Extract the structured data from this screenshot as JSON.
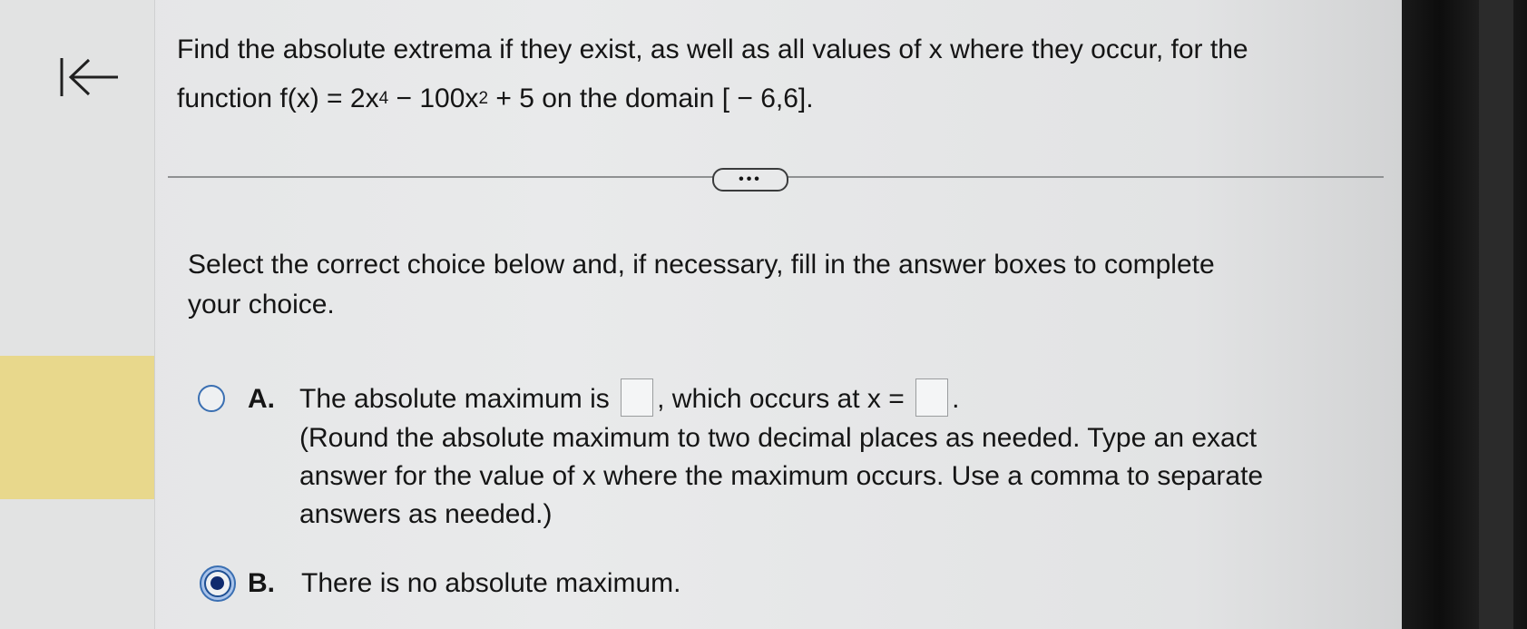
{
  "question": {
    "line1": "Find the absolute extrema if they exist, as well as all values of x where they occur, for the",
    "line2_prefix": "function f(x) = 2x",
    "exp1": "4",
    "line2_mid": " − 100x",
    "exp2": "2",
    "line2_suffix": " + 5 on the domain [ − 6,6]."
  },
  "more_button_label": "•••",
  "instruction": {
    "line1": "Select the correct choice below and, if necessary, fill in the answer boxes to complete",
    "line2": "your choice."
  },
  "choices": {
    "a": {
      "letter": "A.",
      "text_before": "The absolute maximum is",
      "text_middle": ", which occurs at x =",
      "text_after": ".",
      "max_value": "",
      "x_value": "",
      "note": "(Round the absolute maximum to two decimal places as needed. Type an exact answer for the value of x where the maximum occurs. Use a comma to separate answers as needed.)",
      "selected": false
    },
    "b": {
      "letter": "B.",
      "text": "There is no absolute maximum.",
      "selected": true
    }
  },
  "colors": {
    "radio_border": "#3a6fb2",
    "radio_selected_fill": "#0f2a6e",
    "highlight": "#e8d88c"
  },
  "icons": [
    "back-to-start-icon"
  ]
}
